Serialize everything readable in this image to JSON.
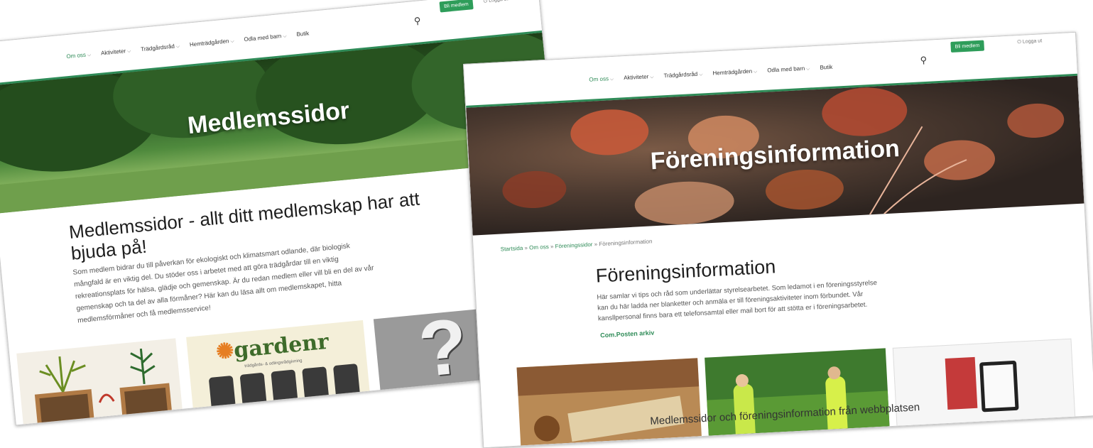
{
  "nav": {
    "items": [
      "Om oss",
      "Aktiviteter",
      "Trädgårdsråd",
      "Hemträdgården",
      "Odla med barn",
      "Butik"
    ],
    "join_label": "Bli medlem",
    "login_label": "Logga ut"
  },
  "left": {
    "hero_title": "Medlemssidor",
    "heading_line1": "Medlemssidor - allt ditt medlemskap har att",
    "heading_line2": "bjuda på!",
    "body_lines": [
      "Som medlem bidrar du till påverkan för ekologiskt och klimatsmart odlande, där biologisk",
      "mångfald är en viktig del. Du stöder oss i arbetet med att göra trädgårdar till en viktig",
      "rekreationsplats för hälsa, glädje och gemenskap. Är du redan medlem eller vill bli en del av vår",
      "gemenskap och ta del av alla förmåner? Här kan du läsa allt om medlemskapet, hitta",
      "medlemsförmåner och få medlemsservice!"
    ],
    "card2_brand": "gardenr",
    "card2_tagline": "trädgårds- & odlingsrådgivning"
  },
  "right": {
    "hero_title": "Föreningsinformation",
    "breadcrumb": [
      "Startsida",
      "Om oss",
      "Föreningssidor",
      "Föreningsinformation"
    ],
    "crumb_sep": "»",
    "heading": "Föreningsinformation",
    "body_lines": [
      "Här samlar vi tips och råd som underlättar styrelsearbetet. Som ledamot i en föreningsstyrelse",
      "kan du här ladda ner blanketter och anmäla er till föreningsaktiviteter inom förbundet. Vår",
      "kansllpersonal finns bara ett telefonsamtal eller mail bort för att stötta er i föreningsarbetet."
    ],
    "archive_link": "Com.Posten arkiv"
  },
  "caption": "Medlemssidor och föreningsinformation från webbplatsen",
  "colors": {
    "accent": "#2e8b57",
    "button": "#2e9d5a"
  },
  "icons": {
    "search": "search-icon",
    "chevron": "chevron-down-icon",
    "power": "power-icon"
  }
}
